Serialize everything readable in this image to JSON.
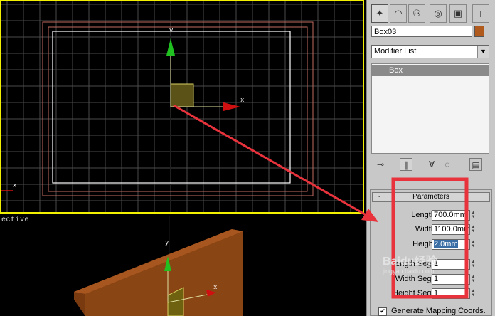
{
  "viewports": {
    "top_axis": {
      "x_label": "x",
      "y_label": "y",
      "corner_x_label": "x"
    },
    "perspective": {
      "label": "ective",
      "y_label": "y",
      "x_label": "x"
    }
  },
  "panel": {
    "tabs": [
      {
        "name": "create-tab",
        "glyph": "✦"
      },
      {
        "name": "modify-tab",
        "glyph": "◠"
      },
      {
        "name": "hierarchy-tab",
        "glyph": "⚇"
      },
      {
        "name": "motion-tab",
        "glyph": "◎"
      },
      {
        "name": "display-tab",
        "glyph": "▣"
      },
      {
        "name": "utilities-tab",
        "glyph": "T"
      }
    ],
    "object_name": "Box03",
    "object_color": "#b15a1e",
    "modifier_list": "Modifier List",
    "modifier_arrow": "▼",
    "stack_items": [
      "Box"
    ],
    "rollout_title": "Parameters",
    "rollout_toggle": "-",
    "params": [
      {
        "label": "Length:",
        "value": "700.0mm"
      },
      {
        "label": "Width:",
        "value": "1100.0mm"
      },
      {
        "label": "Height:",
        "value": "2.0mm"
      },
      {
        "label": "Length Segs:",
        "value": "1"
      },
      {
        "label": "Width Segs:",
        "value": "1"
      },
      {
        "label": "Height Segs:",
        "value": "1"
      }
    ],
    "generate_mapping": "Generate Mapping Coords.",
    "generate_checked": "✔"
  },
  "annotation": {
    "highlight_color": "#e8323c"
  },
  "watermark": {
    "text": "Baidu经验",
    "sub": "jingyan.baidu.com"
  }
}
